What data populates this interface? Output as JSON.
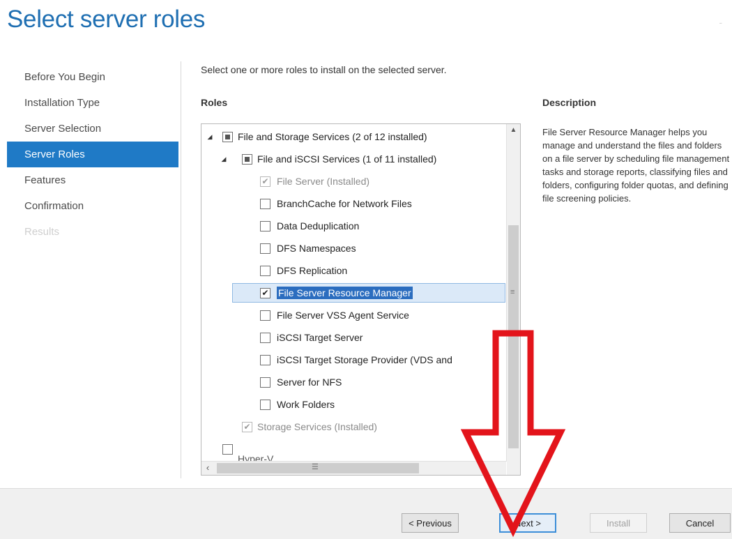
{
  "page": {
    "title": "Select server roles",
    "instruction": "Select one or more roles to install on the selected server."
  },
  "nav": {
    "items": [
      {
        "label": "Before You Begin"
      },
      {
        "label": "Installation Type"
      },
      {
        "label": "Server Selection"
      },
      {
        "label": "Server Roles",
        "active": true
      },
      {
        "label": "Features"
      },
      {
        "label": "Confirmation"
      },
      {
        "label": "Results",
        "disabled": true
      }
    ]
  },
  "roles": {
    "heading": "Roles",
    "items": [
      {
        "label": "File and Storage Services (2 of 12 installed)",
        "state": "partial",
        "expander": "◢",
        "level": 0
      },
      {
        "label": "File and iSCSI Services (1 of 11 installed)",
        "state": "partial",
        "expander": "◢",
        "level": 1
      },
      {
        "label": "File Server (Installed)",
        "state": "checked",
        "dim": true,
        "level": 2
      },
      {
        "label": "BranchCache for Network Files",
        "state": "unchecked",
        "level": 2
      },
      {
        "label": "Data Deduplication",
        "state": "unchecked",
        "level": 2
      },
      {
        "label": "DFS Namespaces",
        "state": "unchecked",
        "level": 2
      },
      {
        "label": "DFS Replication",
        "state": "unchecked",
        "level": 2
      },
      {
        "label": "File Server Resource Manager",
        "state": "checked",
        "selected": true,
        "level": 2
      },
      {
        "label": "File Server VSS Agent Service",
        "state": "unchecked",
        "level": 2
      },
      {
        "label": "iSCSI Target Server",
        "state": "unchecked",
        "level": 2
      },
      {
        "label": "iSCSI Target Storage Provider (VDS and",
        "state": "unchecked",
        "level": 2
      },
      {
        "label": "Server for NFS",
        "state": "unchecked",
        "level": 2
      },
      {
        "label": "Work Folders",
        "state": "unchecked",
        "level": 2
      },
      {
        "label": "Storage Services (Installed)",
        "state": "checked",
        "dim": true,
        "level": 1
      },
      {
        "label": "Hyper-V",
        "state": "unchecked",
        "level": 0,
        "clipped": true
      }
    ]
  },
  "description": {
    "heading": "Description",
    "text": "File Server Resource Manager helps you manage and understand the files and folders on a file server by scheduling file management tasks and storage reports, classifying files and folders, configuring folder quotas, and defining file screening policies."
  },
  "footer": {
    "previous_label": "< Previous",
    "next_label": "Next >",
    "install_label": "Install",
    "cancel_label": "Cancel"
  },
  "colors": {
    "accent": "#1f7ac6",
    "title": "#1f6fb2",
    "annotation_arrow": "#e3141b"
  }
}
